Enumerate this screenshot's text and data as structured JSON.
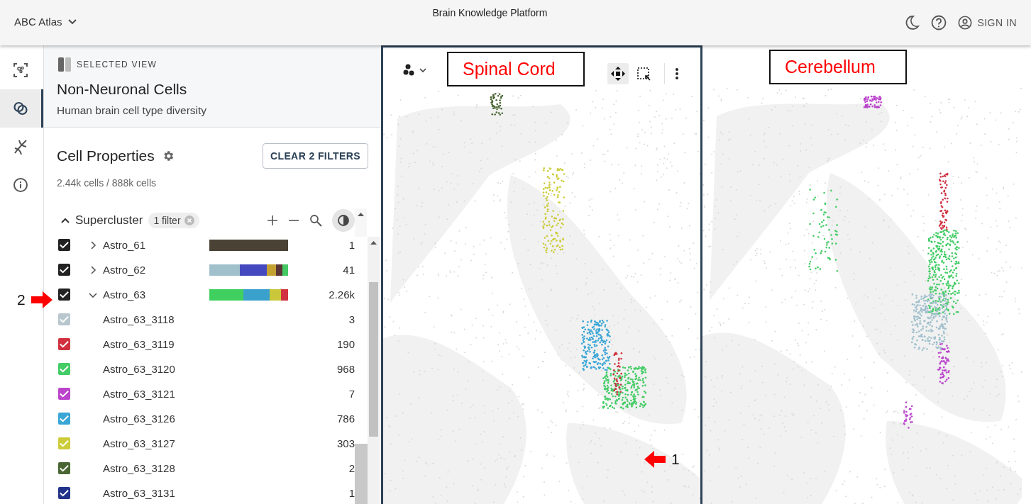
{
  "header": {
    "app_menu": "ABC Atlas",
    "title": "Brain Knowledge Platform",
    "sign_in": "SIGN IN"
  },
  "rail": [
    {
      "kind": "scan",
      "selected": false
    },
    {
      "kind": "overlap",
      "selected": true
    },
    {
      "kind": "dna",
      "selected": false
    },
    {
      "kind": "info",
      "selected": false
    }
  ],
  "selected_view": {
    "caption": "SELECTED VIEW",
    "title": "Non-Neuronal Cells",
    "subtitle": "Human brain cell type diversity"
  },
  "cell_properties": {
    "title": "Cell Properties",
    "clear_button": "CLEAR 2 FILTERS",
    "counts": "2.44k cells / 888k cells",
    "group": {
      "name": "Supercluster",
      "expanded": true,
      "filter_chip": "1 filter"
    },
    "rows": [
      {
        "kind": "cluster",
        "label": "Astro_61",
        "count": "1",
        "checked": true,
        "expanded": false,
        "color": "#222222",
        "segments": [
          {
            "color": "#4a4235"
          }
        ]
      },
      {
        "kind": "cluster",
        "label": "Astro_62",
        "count": "41",
        "checked": true,
        "expanded": false,
        "color": "#222222",
        "segments": [
          {
            "color": "#a0c0cc"
          },
          {
            "color": "#4549c0"
          },
          {
            "color": "#c4a232"
          },
          {
            "color": "#5a3535"
          },
          {
            "color": "#44c864"
          }
        ]
      },
      {
        "kind": "cluster",
        "label": "Astro_63",
        "count": "2.26k",
        "checked": true,
        "expanded": true,
        "color": "#222222",
        "segments": [
          {
            "color": "#40d060"
          },
          {
            "color": "#3aa0cc"
          },
          {
            "color": "#cac83a"
          },
          {
            "color": "#d03040"
          }
        ]
      },
      {
        "kind": "subcluster",
        "label": "Astro_63_3118",
        "count": "3",
        "checked": true,
        "color": "#b8c6ce"
      },
      {
        "kind": "subcluster",
        "label": "Astro_63_3119",
        "count": "190",
        "checked": true,
        "color": "#d0303f"
      },
      {
        "kind": "subcluster",
        "label": "Astro_63_3120",
        "count": "968",
        "checked": true,
        "color": "#44cc66"
      },
      {
        "kind": "subcluster",
        "label": "Astro_63_3121",
        "count": "7",
        "checked": true,
        "color": "#bb44cc"
      },
      {
        "kind": "subcluster",
        "label": "Astro_63_3126",
        "count": "786",
        "checked": true,
        "color": "#3aa6d6"
      },
      {
        "kind": "subcluster",
        "label": "Astro_63_3127",
        "count": "303",
        "checked": true,
        "color": "#cccc3a"
      },
      {
        "kind": "subcluster",
        "label": "Astro_63_3128",
        "count": "2",
        "checked": true,
        "color": "#4a6633"
      },
      {
        "kind": "subcluster",
        "label": "Astro_63_3131",
        "count": "1",
        "checked": true,
        "color": "#22338a"
      }
    ]
  },
  "plots": [
    {
      "label": "Spinal Cord",
      "selected": true,
      "tools": [
        {
          "kind": "pan",
          "selected": true
        },
        {
          "kind": "box-select",
          "selected": false
        }
      ]
    },
    {
      "label": "Cerebellum",
      "selected": false
    }
  ],
  "annotations": [
    {
      "label": "1",
      "kind": "plot"
    },
    {
      "label": "2",
      "kind": "row"
    }
  ]
}
